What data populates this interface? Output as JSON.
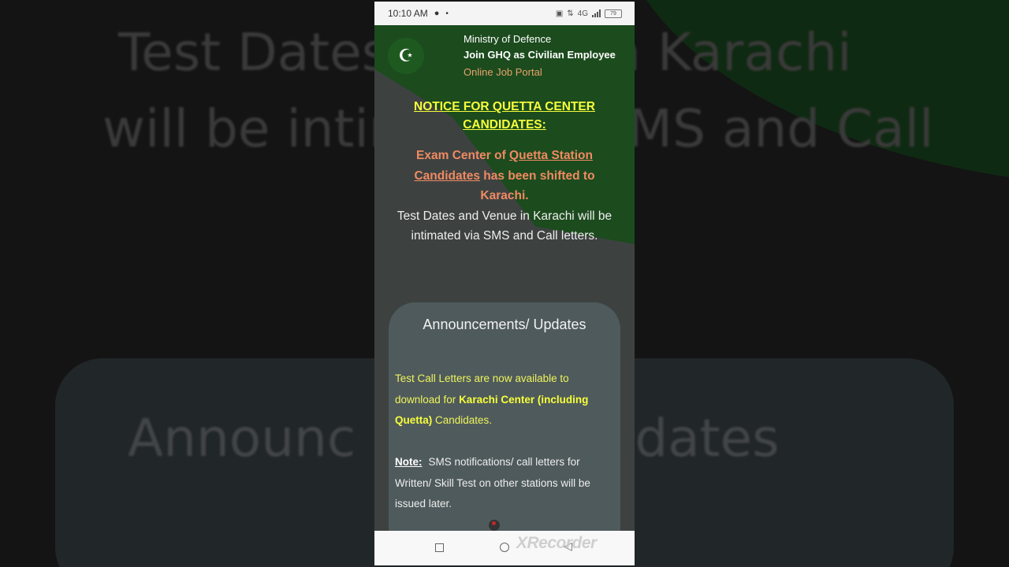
{
  "background": {
    "line1": "Test Dates",
    "line1_tail": "e in Karachi",
    "line2": "will be intim",
    "line2_tail": "MS and Call",
    "line3": "Announc",
    "line3_tail": "Updates"
  },
  "statusbar": {
    "time": "10:10 AM",
    "network": "4G",
    "battery": "79"
  },
  "header": {
    "ministry": "Ministry of Defence",
    "tagline": "Join GHQ as Civilian Employee",
    "portal": "Online Job Portal"
  },
  "notice": {
    "title": "NOTICE FOR QUETTA CENTER CANDIDATES:",
    "red_pre": "Exam Center of ",
    "red_link": "Quetta Station Candidates",
    "red_post": " has been shifted to Karachi.",
    "white": "Test Dates and Venue in Karachi will be intimated via SMS and Call letters."
  },
  "announcements": {
    "title": "Announcements/ Updates",
    "p1_pre": "Test Call Letters are now available to download for ",
    "p1_bold": "Karachi Center (including Quetta)",
    "p1_post": " Candidates.",
    "note_label": "Note:",
    "note_text": "SMS notifications/ call letters for Written/ Skill Test on other stations will be issued later."
  },
  "navbar": {
    "watermark": "XRecorder"
  },
  "colors": {
    "header_green": "#1c4b1e",
    "notice_title": "#f7ff3a",
    "notice_red": "#f08a62",
    "portal_orange": "#e8a36c"
  }
}
